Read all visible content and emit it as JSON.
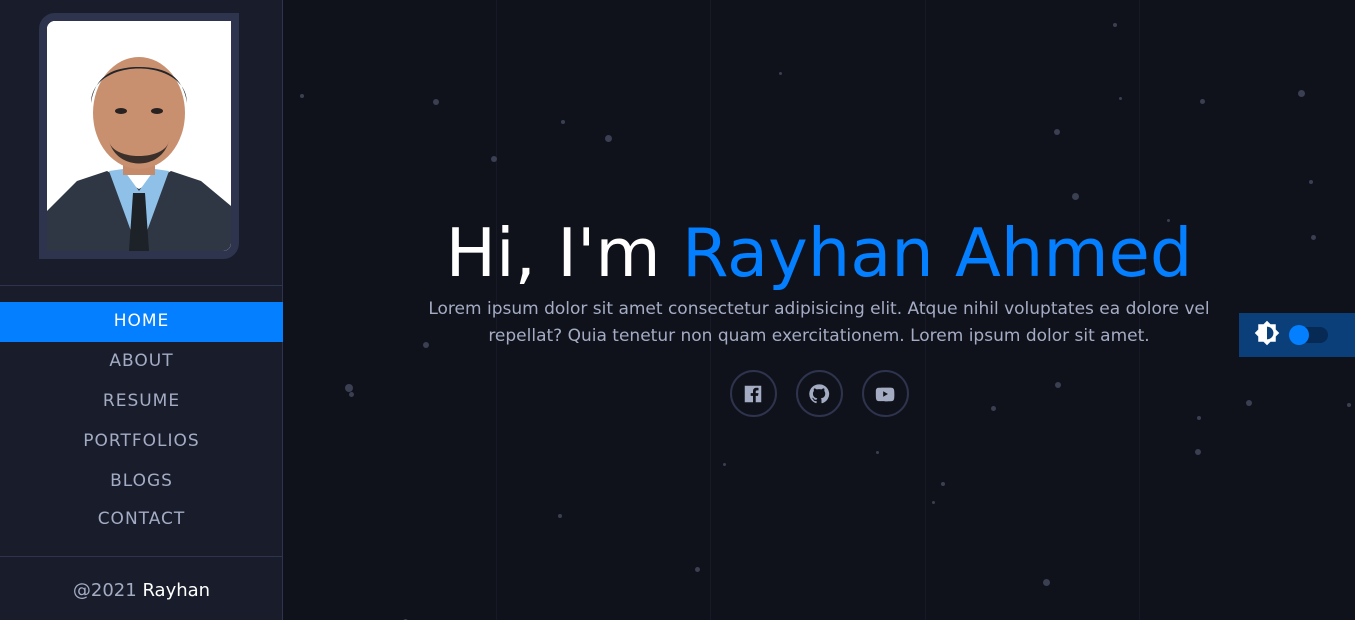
{
  "sidebar": {
    "photo": {
      "alt": "Profile photo of Rayhan Ahmed"
    },
    "nav": [
      {
        "label": "HOME",
        "active": true
      },
      {
        "label": "ABOUT",
        "active": false
      },
      {
        "label": "RESUME",
        "active": false
      },
      {
        "label": "PORTFOLIOS",
        "active": false
      },
      {
        "label": "BLOGS",
        "active": false
      },
      {
        "label": "CONTACT",
        "active": false
      }
    ],
    "copyright": {
      "prefix": "@2021 ",
      "owner": "Rayhan"
    }
  },
  "hero": {
    "greeting": "Hi, I'm ",
    "name": "Rayhan Ahmed",
    "description": "Lorem ipsum dolor sit amet consectetur adipisicing elit. Atque nihil voluptates ea dolore vel repellat? Quia tenetur non quam exercitationem. Lorem ipsum dolor sit amet.",
    "socials": [
      {
        "icon": "facebook-icon"
      },
      {
        "icon": "github-icon"
      },
      {
        "icon": "youtube-icon"
      }
    ]
  },
  "theme_switch": {
    "icon": "brightness-icon",
    "state": "dark"
  },
  "colors": {
    "accent": "#037fff",
    "background": "#10121b",
    "sidebar": "#191d2b",
    "border": "#2e344e",
    "text": "#a4acc4"
  }
}
